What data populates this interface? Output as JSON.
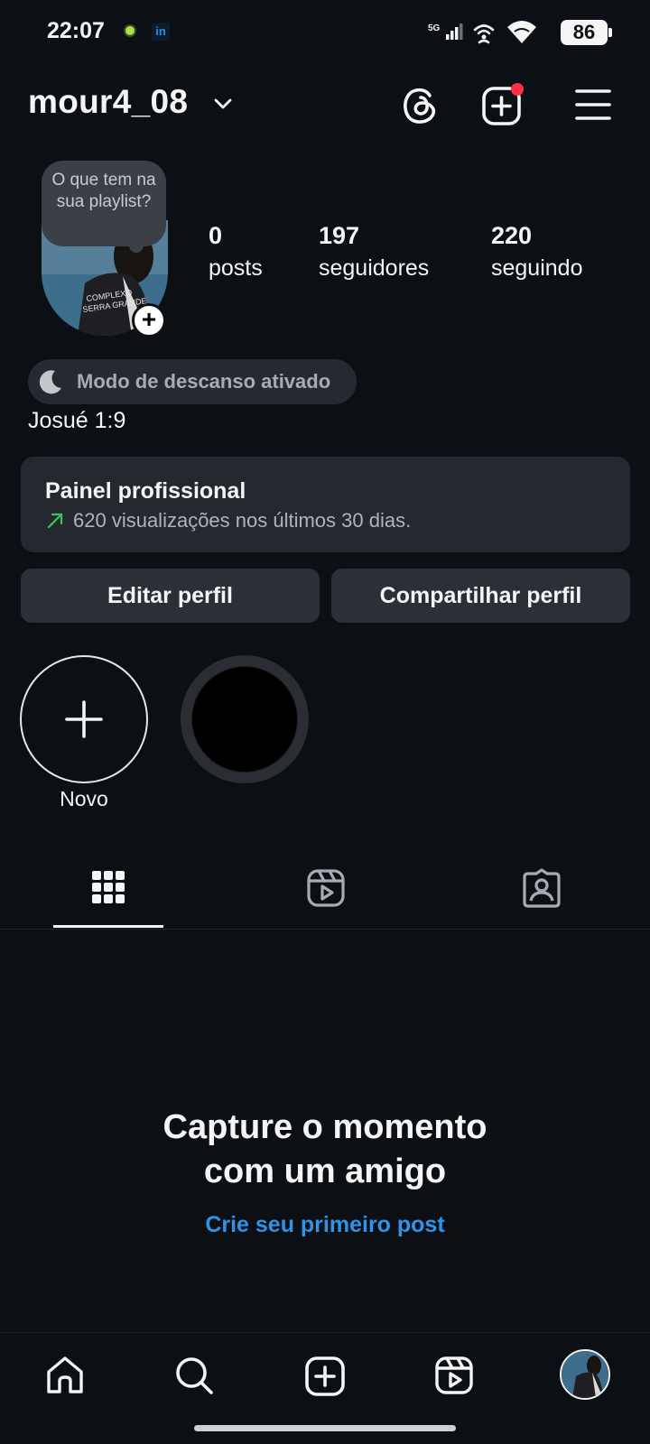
{
  "status_bar": {
    "time": "22:07",
    "network": "5G",
    "battery": "86",
    "notification_icons": [
      "app-dot-icon",
      "linkedin-icon"
    ]
  },
  "header": {
    "username": "mour4_08",
    "actions": [
      "threads-icon",
      "create-icon",
      "menu-icon"
    ],
    "create_badge_color": "#ff3040"
  },
  "profile": {
    "note_text": "O que tem na sua playlist?",
    "stats": [
      {
        "value": "0",
        "label": "posts"
      },
      {
        "value": "197",
        "label": "seguidores"
      },
      {
        "value": "220",
        "label": "seguindo"
      }
    ],
    "rest_mode": "Modo de descanso ativado",
    "bio": "Josué 1:9"
  },
  "professional_panel": {
    "title": "Painel profissional",
    "subtitle": "620 visualizações nos últimos 30 dias.",
    "trend_color": "#3bc45d"
  },
  "buttons": {
    "edit": "Editar perfil",
    "share": "Compartilhar perfil"
  },
  "highlights": {
    "new_label": "Novo"
  },
  "tabs": [
    "grid-icon",
    "reels-icon",
    "tagged-icon"
  ],
  "empty_state": {
    "title_line1": "Capture o momento",
    "title_line2": "com um amigo",
    "link": "Crie seu primeiro post",
    "link_color": "#2f93e8"
  },
  "bottom_nav": [
    "home-icon",
    "search-icon",
    "create-icon",
    "reels-icon",
    "profile-avatar"
  ]
}
